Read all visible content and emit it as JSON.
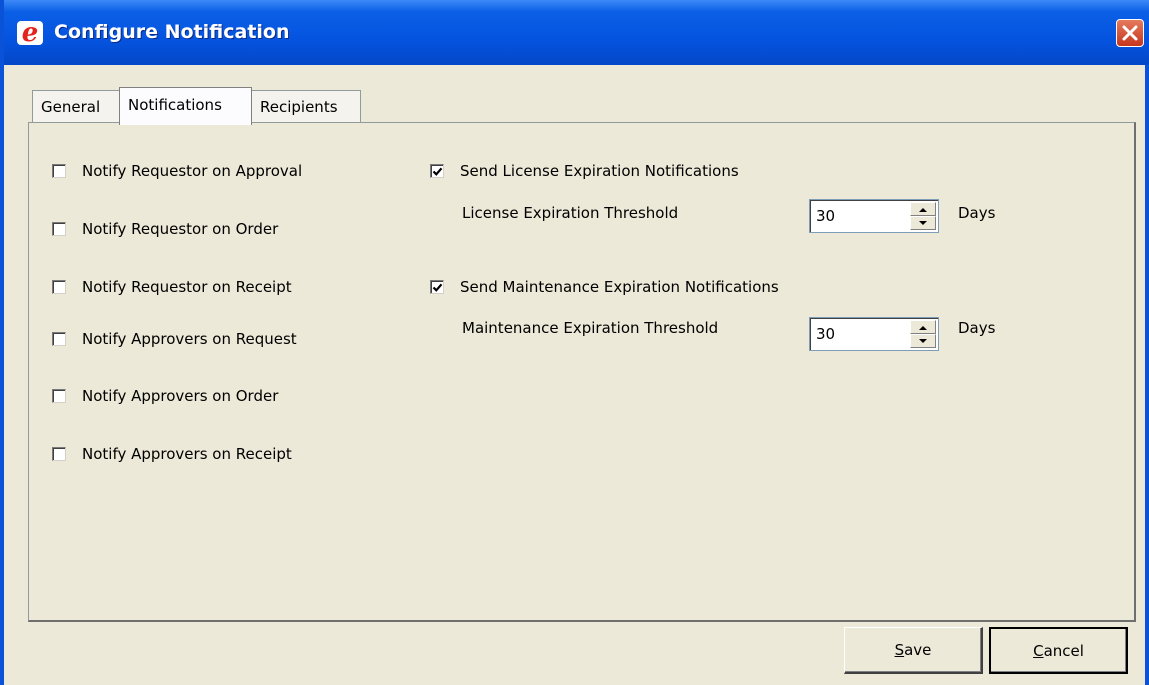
{
  "window": {
    "title": "Configure Notification",
    "app_icon_glyph": "e"
  },
  "tabs": [
    {
      "label": "General",
      "active": false
    },
    {
      "label": "Notifications",
      "active": true
    },
    {
      "label": "Recipients",
      "active": false
    }
  ],
  "left_options": [
    {
      "label": "Notify Requestor on Approval",
      "checked": false
    },
    {
      "label": "Notify Requestor on Order",
      "checked": false
    },
    {
      "label": "Notify Requestor on Receipt",
      "checked": false
    },
    {
      "label": "Notify Approvers on Request",
      "checked": false
    },
    {
      "label": "Notify Approvers on Order",
      "checked": false
    },
    {
      "label": "Notify Approvers on Receipt",
      "checked": false
    }
  ],
  "license": {
    "label": "Send License Expiration Notifications",
    "checked": true,
    "threshold_label": "License Expiration Threshold",
    "threshold_value": "30",
    "unit": "Days"
  },
  "maintenance": {
    "label": "Send Maintenance Expiration Notifications",
    "checked": true,
    "threshold_label": "Maintenance Expiration Threshold",
    "threshold_value": "30",
    "unit": "Days"
  },
  "buttons": {
    "save_mnemonic": "S",
    "save_rest": "ave",
    "cancel_mnemonic": "C",
    "cancel_rest": "ancel"
  },
  "colors": {
    "titlebar": "#0554e0",
    "dialog_bg": "#ece9d8",
    "close_button": "#c5361d"
  },
  "icons": [
    "app-e-icon",
    "close-icon",
    "checkmark-icon",
    "spin-up-icon",
    "spin-down-icon"
  ]
}
